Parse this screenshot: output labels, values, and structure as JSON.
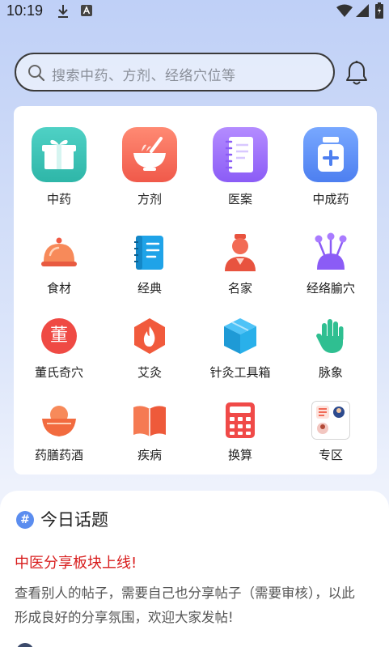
{
  "status_bar": {
    "time": "10:19"
  },
  "search": {
    "placeholder": "搜索中药、方剂、经络穴位等"
  },
  "grid": [
    {
      "label": "中药",
      "icon": "gift-box-icon"
    },
    {
      "label": "方剂",
      "icon": "mortar-bowl-icon"
    },
    {
      "label": "医案",
      "icon": "notebook-icon"
    },
    {
      "label": "中成药",
      "icon": "medicine-bottle-icon"
    },
    {
      "label": "食材",
      "icon": "food-cloche-icon"
    },
    {
      "label": "经典",
      "icon": "classic-book-icon"
    },
    {
      "label": "名家",
      "icon": "scholar-icon"
    },
    {
      "label": "经络腧穴",
      "icon": "acupoint-pins-icon"
    },
    {
      "label": "董氏奇穴",
      "icon": "dong-seal-icon"
    },
    {
      "label": "艾灸",
      "icon": "moxa-flame-icon"
    },
    {
      "label": "针灸工具箱",
      "icon": "toolbox-cube-icon"
    },
    {
      "label": "脉象",
      "icon": "pulse-hand-icon"
    },
    {
      "label": "药膳药酒",
      "icon": "herbal-bowl-icon"
    },
    {
      "label": "疾病",
      "icon": "open-book-icon"
    },
    {
      "label": "换算",
      "icon": "calculator-icon"
    },
    {
      "label": "专区",
      "icon": "zone-grid-icon"
    }
  ],
  "dong_seal_char": "董",
  "topic": {
    "hash": "#",
    "title": "今日话题",
    "headline": "中医分享板块上线!",
    "body": "查看别人的帖子，需要自己也分享帖子（需要审核），以此形成良好的分享氛围，欢迎大家发帖!"
  },
  "colors": {
    "headline": "#d81c1c",
    "accent": "#5b8def"
  }
}
